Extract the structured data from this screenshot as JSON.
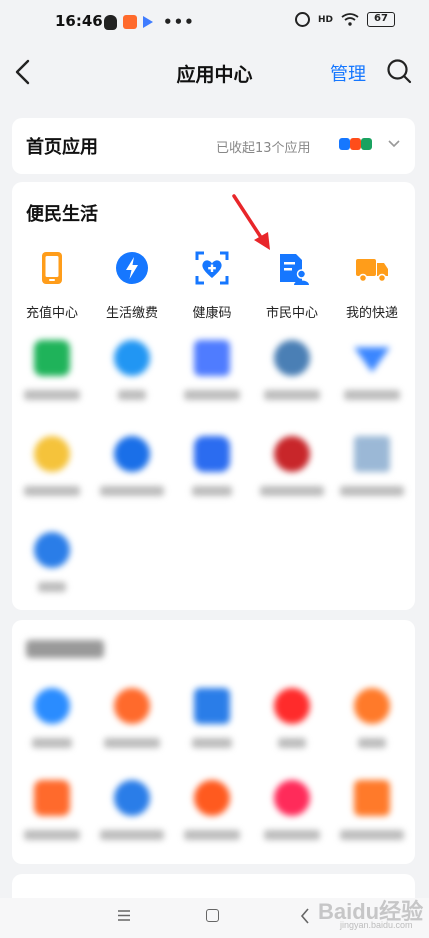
{
  "status_bar": {
    "time": "16:46",
    "more": "•••",
    "signal": "HD",
    "battery": "67"
  },
  "nav": {
    "title": "应用中心",
    "manage": "管理"
  },
  "home_apps": {
    "title": "首页应用",
    "info": "已收起13个应用"
  },
  "life": {
    "title": "便民生活",
    "apps": [
      {
        "label": "充值中心",
        "icon": "phone-icon",
        "color": "#ff9d1a"
      },
      {
        "label": "生活缴费",
        "icon": "bolt-drop-icon",
        "color": "#1677ff"
      },
      {
        "label": "健康码",
        "icon": "health-code-icon",
        "color": "#1677ff"
      },
      {
        "label": "市民中心",
        "icon": "citizen-card-icon",
        "color": "#1677ff"
      },
      {
        "label": "我的快递",
        "icon": "truck-icon",
        "color": "#ff9d1a"
      }
    ]
  },
  "accent_color": "#1677ff",
  "arrow_color": "#e8262a",
  "watermark": {
    "text": "Baidu经验",
    "sub": "jingyan.baidu.com"
  }
}
